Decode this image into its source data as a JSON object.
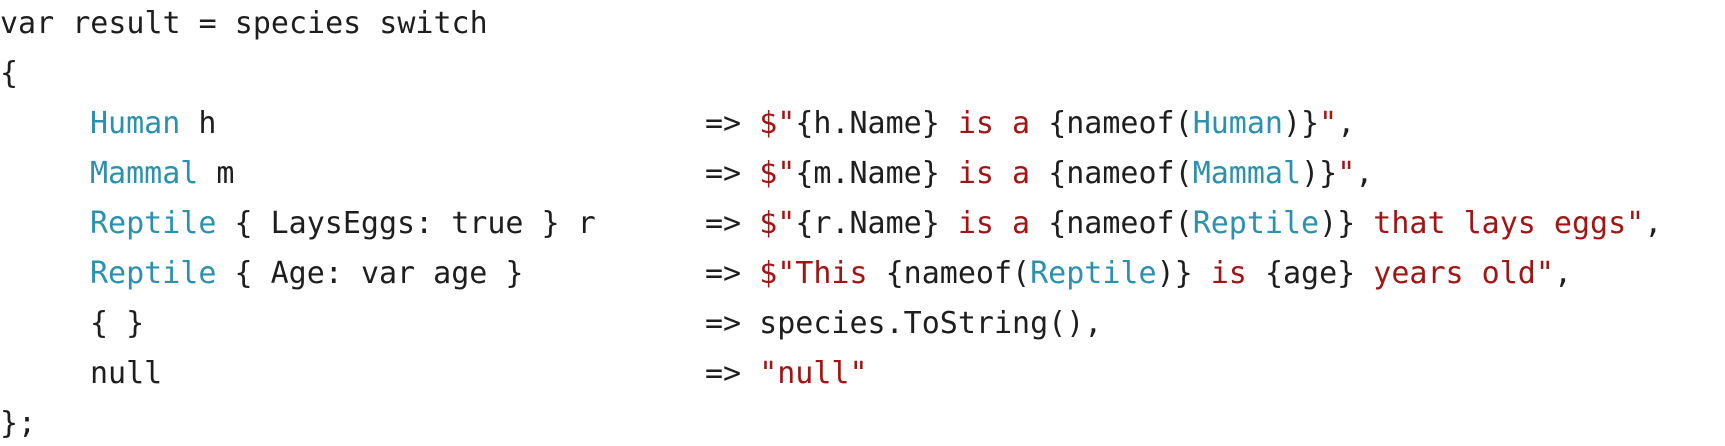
{
  "colors": {
    "plain": "#1e1e1e",
    "keyword": "#1e1e1e",
    "type": "#2b91af",
    "string": "#a31515",
    "interp": "#1e1e1e",
    "background": "#ffffff"
  },
  "code": {
    "header": [
      {
        "t": "var",
        "c": "keyword"
      },
      {
        "t": " result = species ",
        "c": "plain"
      },
      {
        "t": "switch",
        "c": "keyword"
      }
    ],
    "open": [
      {
        "t": "{",
        "c": "plain"
      }
    ],
    "arms": [
      {
        "pattern": [
          {
            "t": "Human",
            "c": "type"
          },
          {
            "t": " h",
            "c": "plain"
          }
        ],
        "expr": [
          {
            "t": "=> ",
            "c": "plain"
          },
          {
            "t": "$\"",
            "c": "string"
          },
          {
            "t": "{h.Name}",
            "c": "interp"
          },
          {
            "t": " is a ",
            "c": "string"
          },
          {
            "t": "{nameof(",
            "c": "interp"
          },
          {
            "t": "Human",
            "c": "type"
          },
          {
            "t": ")}",
            "c": "interp"
          },
          {
            "t": "\"",
            "c": "string"
          },
          {
            "t": ",",
            "c": "plain"
          }
        ]
      },
      {
        "pattern": [
          {
            "t": "Mammal",
            "c": "type"
          },
          {
            "t": " m",
            "c": "plain"
          }
        ],
        "expr": [
          {
            "t": "=> ",
            "c": "plain"
          },
          {
            "t": "$\"",
            "c": "string"
          },
          {
            "t": "{m.Name}",
            "c": "interp"
          },
          {
            "t": " is a ",
            "c": "string"
          },
          {
            "t": "{nameof(",
            "c": "interp"
          },
          {
            "t": "Mammal",
            "c": "type"
          },
          {
            "t": ")}",
            "c": "interp"
          },
          {
            "t": "\"",
            "c": "string"
          },
          {
            "t": ",",
            "c": "plain"
          }
        ]
      },
      {
        "pattern": [
          {
            "t": "Reptile",
            "c": "type"
          },
          {
            "t": " { LaysEggs: ",
            "c": "plain"
          },
          {
            "t": "true",
            "c": "keyword"
          },
          {
            "t": " } r",
            "c": "plain"
          }
        ],
        "expr": [
          {
            "t": "=> ",
            "c": "plain"
          },
          {
            "t": "$\"",
            "c": "string"
          },
          {
            "t": "{r.Name}",
            "c": "interp"
          },
          {
            "t": " is a ",
            "c": "string"
          },
          {
            "t": "{nameof(",
            "c": "interp"
          },
          {
            "t": "Reptile",
            "c": "type"
          },
          {
            "t": ")}",
            "c": "interp"
          },
          {
            "t": " that lays eggs\"",
            "c": "string"
          },
          {
            "t": ",",
            "c": "plain"
          }
        ]
      },
      {
        "pattern": [
          {
            "t": "Reptile",
            "c": "type"
          },
          {
            "t": " { Age: ",
            "c": "plain"
          },
          {
            "t": "var",
            "c": "keyword"
          },
          {
            "t": " age }",
            "c": "plain"
          }
        ],
        "expr": [
          {
            "t": "=> ",
            "c": "plain"
          },
          {
            "t": "$\"This ",
            "c": "string"
          },
          {
            "t": "{nameof(",
            "c": "interp"
          },
          {
            "t": "Reptile",
            "c": "type"
          },
          {
            "t": ")}",
            "c": "interp"
          },
          {
            "t": " is ",
            "c": "string"
          },
          {
            "t": "{age}",
            "c": "interp"
          },
          {
            "t": " years old\"",
            "c": "string"
          },
          {
            "t": ",",
            "c": "plain"
          }
        ]
      },
      {
        "pattern": [
          {
            "t": "{ }",
            "c": "plain"
          }
        ],
        "expr": [
          {
            "t": "=> species.ToString(),",
            "c": "plain"
          }
        ]
      },
      {
        "pattern": [
          {
            "t": "null",
            "c": "keyword"
          }
        ],
        "expr": [
          {
            "t": "=> ",
            "c": "plain"
          },
          {
            "t": "\"null\"",
            "c": "string"
          }
        ]
      }
    ],
    "close": [
      {
        "t": "};",
        "c": "plain"
      }
    ]
  }
}
